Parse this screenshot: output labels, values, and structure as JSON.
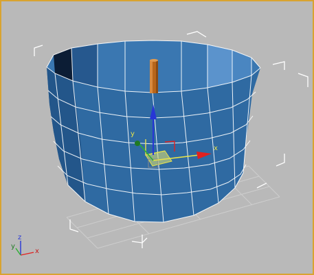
{
  "viewport": {
    "name": "perspective-viewport",
    "background": "#b9b9b9",
    "border_color": "#d8a330"
  },
  "scene": {
    "object": "cylinder",
    "object_color": "#2e6aa3",
    "wireframe_color": "#ffffff",
    "selected_object": "wooden-post",
    "selected_color": "#b8661b",
    "selection_bracket_color": "#ffffff"
  },
  "gizmo": {
    "type": "move",
    "x_label": "x",
    "y_label": "y",
    "colors": {
      "x": "#e2201f",
      "y": "#2cb131",
      "z": "#2736d6",
      "plane": "#e8e34a"
    }
  },
  "world_axis": {
    "x_label": "x",
    "y_label": "y",
    "z_label": "z"
  }
}
